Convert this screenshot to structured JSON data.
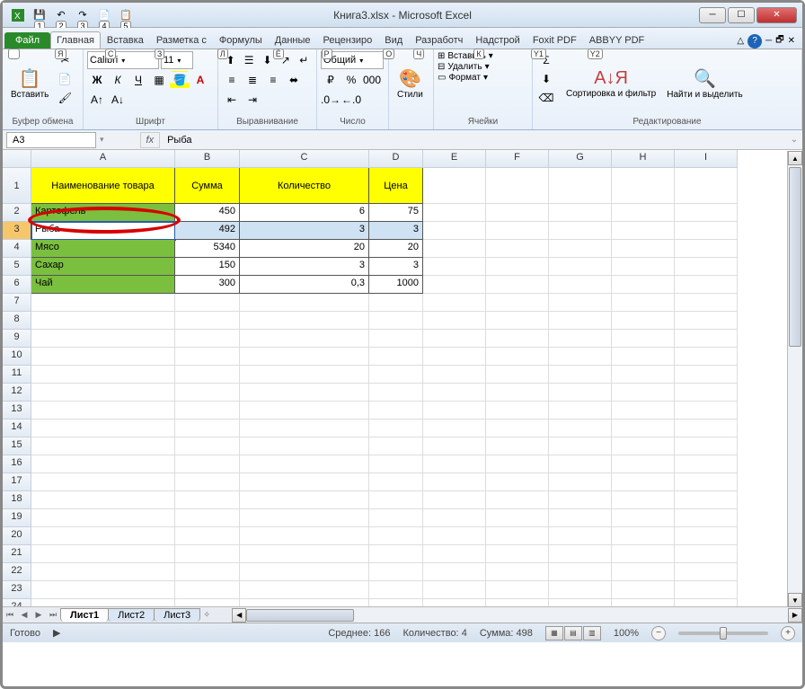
{
  "window": {
    "title": "Книга3.xlsx - Microsoft Excel"
  },
  "qat_kbds": [
    "1",
    "2",
    "3",
    "4",
    "5"
  ],
  "tabs": {
    "file": "Файл",
    "file_kbd": "Ф",
    "home": "Главная",
    "home_kbd": "Я",
    "insert": "Вставка",
    "insert_kbd": "С",
    "layout": "Разметка с",
    "layout_kbd": "З",
    "formulas": "Формулы",
    "formulas_kbd": "Л",
    "data": "Данные",
    "data_kbd": "Ё",
    "review": "Рецензиро",
    "review_kbd": "Р",
    "view": "Вид",
    "view_kbd": "О",
    "developer": "Разработч",
    "developer_kbd": "Ч",
    "addins": "Надстрой",
    "addins_kbd": "К",
    "foxit": "Foxit PDF",
    "foxit_kbd": "Y1",
    "abbyy": "ABBYY PDF",
    "abbyy_kbd": "Y2"
  },
  "ribbon": {
    "paste": "Вставить",
    "clipboard": "Буфер обмена",
    "font_name": "Calibri",
    "font_size": "11",
    "font_group": "Шрифт",
    "align_group": "Выравнивание",
    "number_format": "Общий",
    "number_group": "Число",
    "styles": "Стили",
    "insert_cell": "Вставить",
    "delete_cell": "Удалить",
    "format_cell": "Формат",
    "cells_group": "Ячейки",
    "sort_filter": "Сортировка и фильтр",
    "find_select": "Найти и выделить",
    "editing_group": "Редактирование"
  },
  "name_box": "A3",
  "formula_value": "Рыба",
  "columns": [
    "A",
    "B",
    "C",
    "D",
    "E",
    "F",
    "G",
    "H",
    "I"
  ],
  "row_numbers": [
    "1",
    "2",
    "3",
    "4",
    "5",
    "6",
    "7",
    "8",
    "9",
    "10",
    "11",
    "12",
    "13",
    "14",
    "15",
    "16",
    "17",
    "18",
    "19",
    "20",
    "21",
    "22",
    "23",
    "24"
  ],
  "headers": {
    "a": "Наименование товара",
    "b": "Сумма",
    "c": "Количество",
    "d": "Цена"
  },
  "rows": [
    {
      "name": "Картофель",
      "sum": "450",
      "qty": "6",
      "price": "75"
    },
    {
      "name": "Рыба",
      "sum": "492",
      "qty": "3",
      "price": "3"
    },
    {
      "name": "Мясо",
      "sum": "5340",
      "qty": "20",
      "price": "20"
    },
    {
      "name": "Сахар",
      "sum": "150",
      "qty": "3",
      "price": "3"
    },
    {
      "name": "Чай",
      "sum": "300",
      "qty": "0,3",
      "price": "1000"
    }
  ],
  "sheets": {
    "s1": "Лист1",
    "s2": "Лист2",
    "s3": "Лист3"
  },
  "status": {
    "ready": "Готово",
    "avg_label": "Среднее:",
    "avg": "166",
    "count_label": "Количество:",
    "count": "4",
    "sum_label": "Сумма:",
    "sum": "498",
    "zoom": "100%"
  }
}
